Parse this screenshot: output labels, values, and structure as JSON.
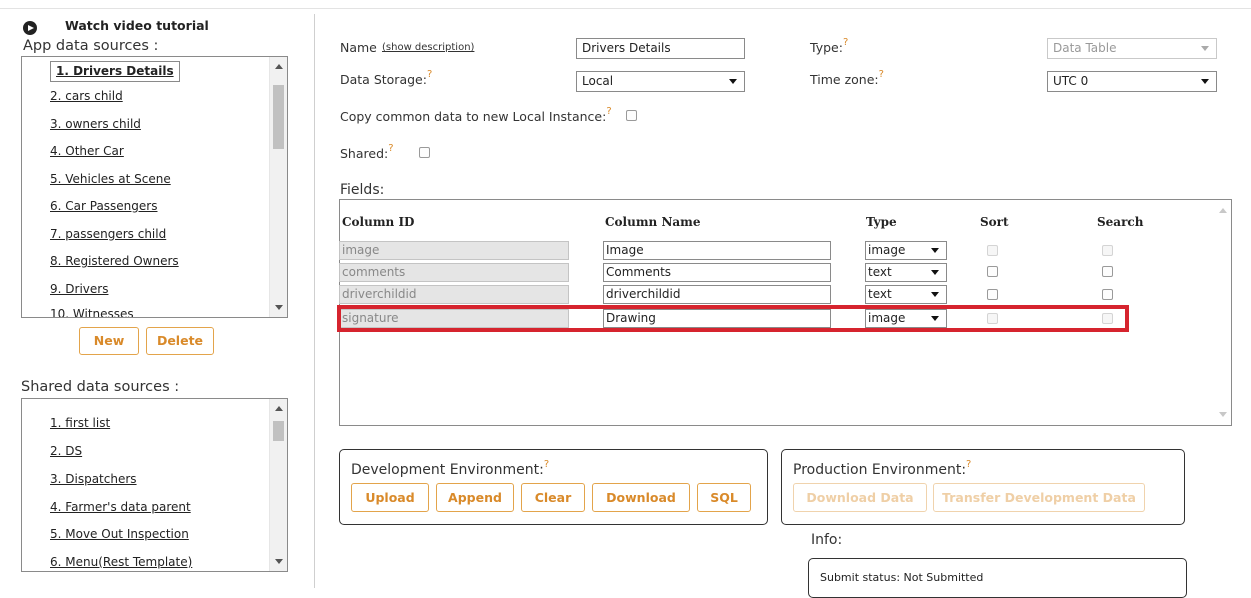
{
  "video_tutorial": "Watch video tutorial",
  "app_sources": {
    "title": "App data sources :",
    "items": [
      "1. Drivers Details",
      "2. cars child",
      "3. owners child",
      "4. Other Car",
      "5. Vehicles at Scene",
      "6. Car Passengers",
      "7. passengers child",
      "8. Registered Owners",
      "9. Drivers",
      "10. Witnesses"
    ],
    "new_label": "New",
    "delete_label": "Delete"
  },
  "shared_sources": {
    "title": "Shared data sources :",
    "items": [
      "1. first list",
      "2. DS",
      "3. Dispatchers",
      "4. Farmer's data parent",
      "5. Move Out Inspection",
      "6. Menu(Rest Template)"
    ]
  },
  "form": {
    "name_label": "Name",
    "show_description": "(show description)",
    "name_value": "Drivers Details",
    "type_label": "Type:",
    "type_value": "Data Table",
    "storage_label": "Data Storage:",
    "storage_value": "Local",
    "timezone_label": "Time zone:",
    "timezone_value": "UTC 0",
    "copy_label": "Copy common data to new Local Instance:",
    "shared_label": "Shared:",
    "help_mark": "?"
  },
  "fields": {
    "title": "Fields:",
    "headers": {
      "column_id": "Column ID",
      "column_name": "Column Name",
      "type": "Type",
      "sort": "Sort",
      "search": "Search"
    },
    "rows": [
      {
        "id": "image",
        "name": "Image",
        "type": "image"
      },
      {
        "id": "comments",
        "name": "Comments",
        "type": "text"
      },
      {
        "id": "driverchildid",
        "name": "driverchildid",
        "type": "text"
      },
      {
        "id": "signature",
        "name": "Drawing",
        "type": "image"
      }
    ],
    "highlight_color": "#d6242e"
  },
  "dev_env": {
    "title": "Development Environment:",
    "buttons": [
      "Upload",
      "Append",
      "Clear",
      "Download",
      "SQL"
    ]
  },
  "prod_env": {
    "title": "Production Environment:",
    "buttons": [
      "Download Data",
      "Transfer Development Data"
    ]
  },
  "info": {
    "label": "Info:",
    "submit_status": "Submit status: Not Submitted"
  },
  "colors": {
    "accent": "#d98a2a",
    "highlight": "#d6242e"
  }
}
